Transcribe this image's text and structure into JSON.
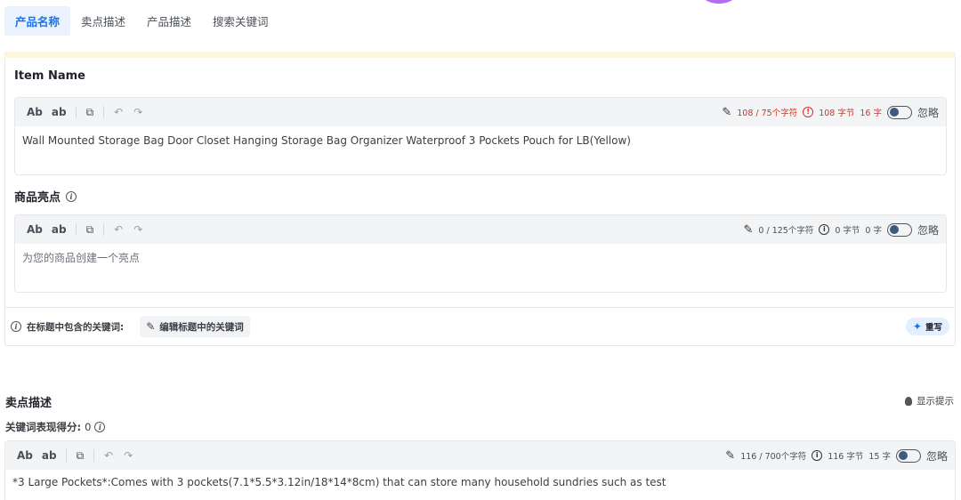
{
  "tabs": [
    "产品名称",
    "卖点描述",
    "产品描述",
    "搜索关键词"
  ],
  "item_name": {
    "title": "Item Name",
    "toolbar": {
      "ab_upper": "Ab",
      "ab_lower": "ab",
      "char_count": "108 / 75个字符",
      "bytes": "108 字节",
      "words": "16 字",
      "ignore": "忽略"
    },
    "text": "Wall Mounted Storage Bag Door Closet Hanging Storage Bag Organizer Waterproof 3 Pockets Pouch for LB(Yellow)"
  },
  "highlight": {
    "title": "商品亮点",
    "toolbar": {
      "ab_upper": "Ab",
      "ab_lower": "ab",
      "char_count": "0 / 125个字符",
      "bytes": "0 字节",
      "words": "0 字",
      "ignore": "忽略"
    },
    "placeholder": "为您的商品创建一个亮点"
  },
  "keywords": {
    "label": "在标题中包含的关键词:",
    "edit_button": "编辑标题中的关键词",
    "rewrite": "重写"
  },
  "selling_points": {
    "title": "卖点描述",
    "hint": "显示提示",
    "score_label": "关键词表现得分:",
    "score_value": "0",
    "toolbar": {
      "ab_upper": "Ab",
      "ab_lower": "ab",
      "char_count": "116 / 700个字符",
      "bytes": "116 字节",
      "words": "15 字",
      "ignore": "忽略"
    },
    "text": "*3 Large Pockets*:Comes with 3 pockets(7.1*5.5*3.12in/18*14*8cm) that can store many household sundries such as test"
  },
  "icons": {
    "pencil": "pencil-icon",
    "info": "info-icon",
    "warning": "warning-icon",
    "copy": "copy-icon",
    "undo": "undo-icon",
    "redo": "redo-icon",
    "sparkle": "sparkle-icon",
    "bulb": "bulb-icon"
  },
  "colors": {
    "accent": "#1a73e8",
    "error": "#d93025",
    "toolbar_bg": "#f3f4f6",
    "tab_active_bg": "#e9f2fd",
    "strip": "#fdf6dc"
  }
}
